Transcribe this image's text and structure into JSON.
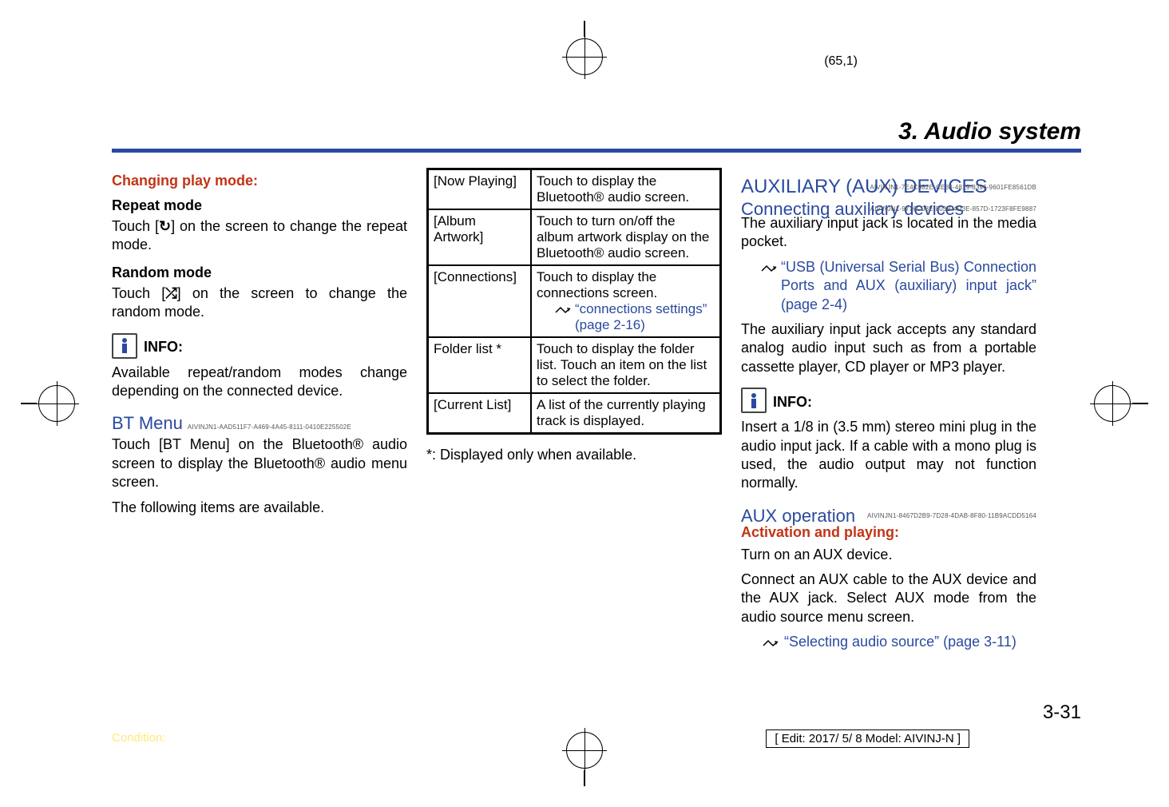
{
  "top_indicator": "(65,1)",
  "chapter_title": "3. Audio system",
  "col1": {
    "changing_mode": "Changing play mode:",
    "repeat_mode_h": "Repeat mode",
    "repeat_body_a": "Touch [",
    "repeat_body_b": "] on the screen to change the repeat mode.",
    "random_mode_h": "Random mode",
    "random_body_a": "Touch [",
    "random_body_b": "] on the screen to change the random mode.",
    "info_label": "INFO:",
    "info_body": "Available repeat/random modes change depending on the connected device.",
    "bt_menu": "BT Menu",
    "bt_menu_id": "AIVINJN1-AAD511F7-A469-4A45-8111-0410E225502E",
    "bt_body1": "Touch [BT Menu] on the Bluetooth® audio screen to display the Bluetooth® audio menu screen.",
    "bt_body2": "The following items are available."
  },
  "table": {
    "rows": [
      {
        "k": "[Now Playing]",
        "v": "Touch to display the Bluetooth® audio screen."
      },
      {
        "k": "[Album Artwork]",
        "v": "Touch to turn on/off the album artwork display on the Bluetooth® audio screen."
      },
      {
        "k": "[Connections]",
        "v_main": "Touch to display the connections screen.",
        "v_ref": "“connections settings” (page 2-16)"
      },
      {
        "k": "Folder list *",
        "v": "Touch to display the folder list. Touch an item on the list to select the folder."
      },
      {
        "k": "[Current List]",
        "v": "A list of the currently playing track is displayed."
      }
    ],
    "footnote": "*: Displayed only when available."
  },
  "col3": {
    "aux_devices": "AUXILIARY (AUX) DEVICES",
    "aux_devices_id": "AIVINJN1-7E4C982E-CE83-4819-8396-9601FE8561DB",
    "connecting": "Connecting auxiliary devices",
    "connecting_id": "AIVINJN1-9776C08E-803B-4D3E-857D-1723F8FE9887",
    "conn_body": "The auxiliary input jack is located in the media pocket.",
    "conn_ref": "“USB (Universal Serial Bus) Connection Ports and AUX (auxiliary) input jack” (page 2-4)",
    "conn_body2": "The auxiliary input jack accepts any standard analog audio input such as from a portable cassette player, CD player or MP3 player.",
    "info_label": "INFO:",
    "info_body": "Insert a 1/8 in (3.5 mm) stereo mini plug in the audio input jack. If a cable with a mono plug is used, the audio output may not function normally.",
    "aux_op": "AUX operation",
    "aux_op_id": "AIVINJN1-8467D2B9-7D28-4DAB-8F80-11B9ACDD5164",
    "activation": "Activation and playing:",
    "act_body1": "Turn on an AUX device.",
    "act_body2": "Connect an AUX cable to the AUX device and the AUX jack. Select AUX mode from the audio source menu screen.",
    "act_ref": "“Selecting audio source” (page 3-11)"
  },
  "page_num": "3-31",
  "condition_label": "Condition:",
  "edit_label": "[ Edit: 2017/ 5/ 8    Model:  AIVINJ-N ]"
}
